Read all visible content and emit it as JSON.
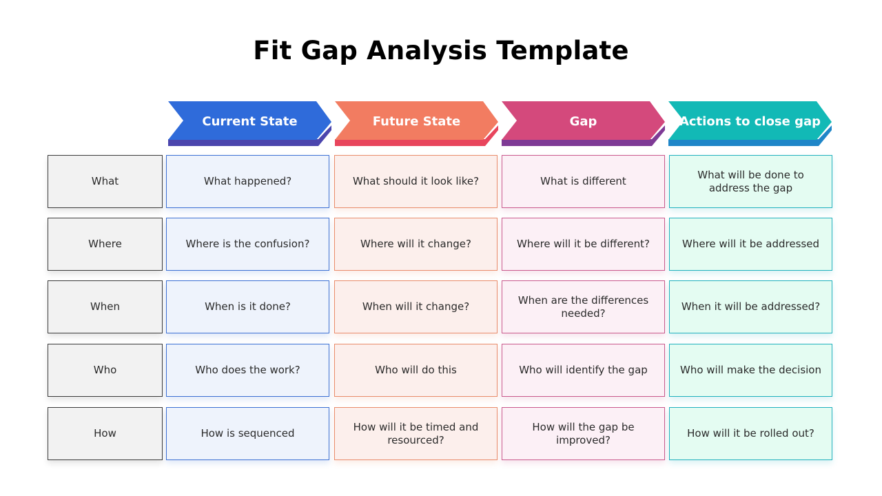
{
  "title": "Fit Gap Analysis Template",
  "columns": [
    {
      "label": "Current State",
      "color": "#2f6bda",
      "shade": "#4b45ad"
    },
    {
      "label": "Future State",
      "color": "#f27c61",
      "shade": "#e8455c"
    },
    {
      "label": "Gap",
      "color": "#d4497c",
      "shade": "#7e3a95"
    },
    {
      "label": "Actions to close gap",
      "color": "#12b9b6",
      "shade": "#1f86c8"
    }
  ],
  "rows": [
    {
      "label": "What",
      "cells": [
        "What happened?",
        "What should it look like?",
        "What is different",
        "What will be done to address the gap"
      ]
    },
    {
      "label": "Where",
      "cells": [
        "Where is the confusion?",
        "Where will it change?",
        "Where will it be different?",
        "Where will it be addressed"
      ]
    },
    {
      "label": "When",
      "cells": [
        "When is it done?",
        "When will it change?",
        "When are the differences needed?",
        "When it will be addressed?"
      ]
    },
    {
      "label": "Who",
      "cells": [
        "Who does the work?",
        "Who will do this",
        "Who will identify the gap",
        "Who will make the decision"
      ]
    },
    {
      "label": "How",
      "cells": [
        "How is sequenced",
        "How will it be timed and resourced?",
        "How will the gap be improved?",
        "How will it be rolled out?"
      ]
    }
  ]
}
